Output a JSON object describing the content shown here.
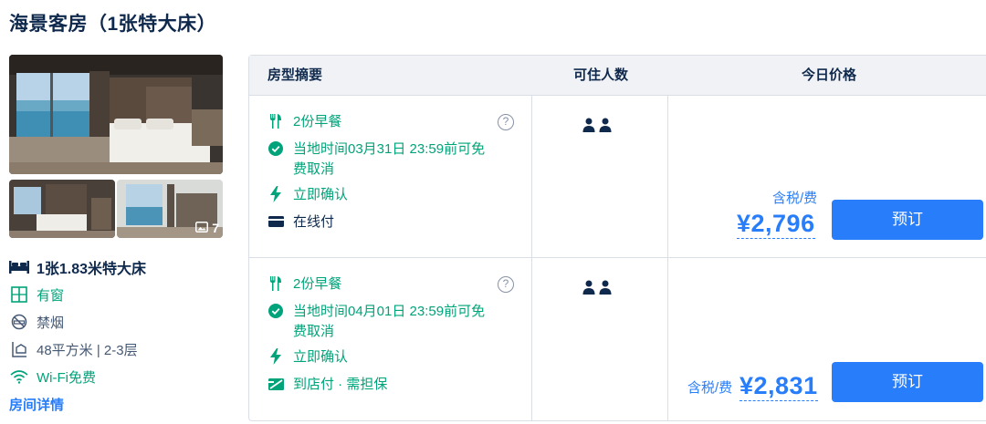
{
  "room": {
    "title": "海景客房（1张特大床）",
    "photo_count": "7",
    "bed": "1张1.83米特大床",
    "window": "有窗",
    "smoking": "禁烟",
    "area_floor": "48平方米 | 2-3层",
    "wifi": "Wi-Fi免费",
    "details_link": "房间详情",
    "icons": [
      "bed-icon",
      "window-icon",
      "no-smoking-icon",
      "area-icon",
      "wifi-icon",
      "image-icon"
    ]
  },
  "table": {
    "headers": {
      "summary": "房型摘要",
      "guests": "可住人数",
      "price": "今日价格"
    },
    "rows": [
      {
        "breakfast": "2份早餐",
        "cancel": "当地时间03月31日 23:59前可免费取消",
        "cancel_line1": "当地时间03月31日 23:59前可免",
        "cancel_line2": "费取消",
        "confirm": "立即确认",
        "payment": "在线付",
        "help": "?",
        "guests": 2,
        "tax_label": "含税/费",
        "price": "¥2,796",
        "book_label": "预订"
      },
      {
        "breakfast": "2份早餐",
        "cancel": "当地时间04月01日 23:59前可免费取消",
        "cancel_line1": "当地时间04月01日 23:59前可免",
        "cancel_line2": "费取消",
        "confirm": "立即确认",
        "payment": "到店付 · 需担保",
        "help": "?",
        "guests": 2,
        "tax_label": "含税/费",
        "price": "¥2,831",
        "book_label": "预订"
      }
    ]
  },
  "colors": {
    "accent": "#287dfa",
    "green": "#00a37a",
    "text": "#0f294d",
    "muted": "#455873",
    "border": "#dadfe6",
    "header_bg": "#f0f2f5"
  }
}
